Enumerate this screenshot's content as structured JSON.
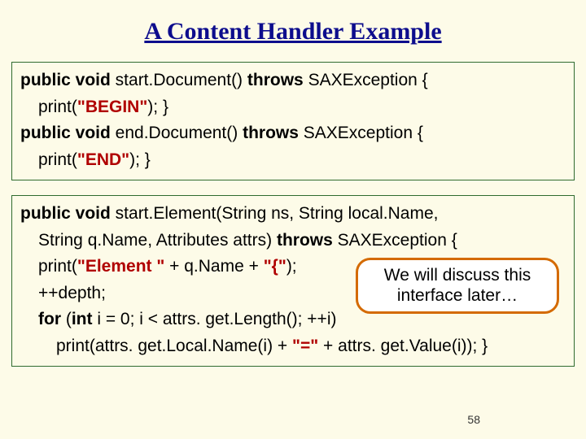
{
  "title": "A Content Handler Example",
  "block1": {
    "sig_kw1": "public void",
    "sig_name1": " start.Document() ",
    "sig_kw2": "throws",
    "sig_rest1": " SAXException {",
    "body1_a": "print(",
    "body1_str": "\"BEGIN\"",
    "body1_b": "); }",
    "sig_kw3": "public void",
    "sig_name2": " end.Document() ",
    "sig_kw4": "throws",
    "sig_rest2": " SAXException {",
    "body2_a": "print(",
    "body2_str": "\"END\"",
    "body2_b": "); }"
  },
  "block2": {
    "l1_kw": "public void",
    "l1_rest": " start.Element(String ns, String local.Name,",
    "l2_a": "String q.Name, Attributes attrs) ",
    "l2_kw": "throws",
    "l2_b": " SAXException {",
    "l3_a": "print(",
    "l3_s1": "\"Element \"",
    "l3_b": " + q.Name + ",
    "l3_s2": "\"{\"",
    "l3_c": ");",
    "l4": "++depth;",
    "l5_kw1": "for",
    "l5_a": " (",
    "l5_kw2": "int",
    "l5_b": " i = 0; i < attrs. get.Length(); ++i)",
    "l6_a": "print(attrs. get.Local.Name(i) + ",
    "l6_s1": "\"=\"",
    "l6_b": " + attrs. get.Value(i)); }"
  },
  "callout": {
    "line1": "We will discuss this",
    "line2": "interface later…"
  },
  "pagenum": "58"
}
